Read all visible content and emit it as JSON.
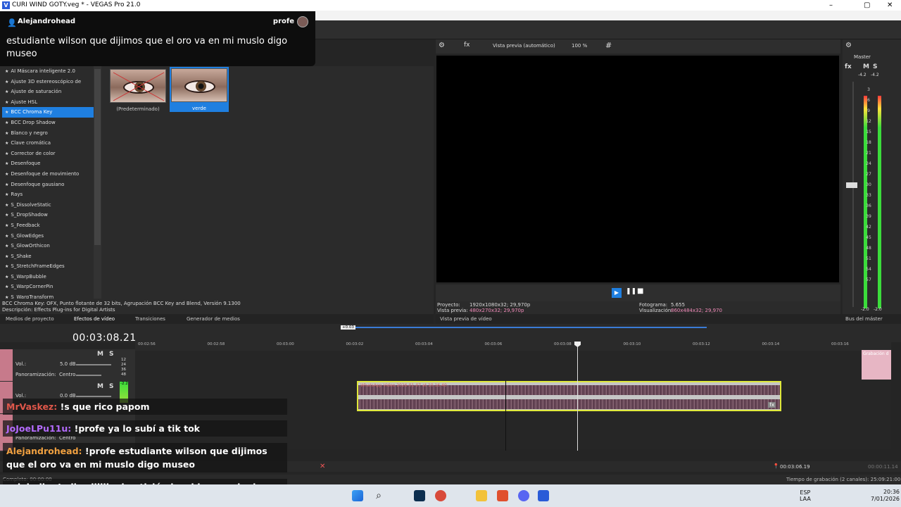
{
  "window": {
    "logo": "V",
    "title": "CURI WIND GOTY.veg * - VEGAS Pro 21.0",
    "minimize": "–",
    "maximize": "▢",
    "close": "✕"
  },
  "stream_overlay": {
    "username": "Alejandrohead",
    "badge": "profe",
    "message": "estudiante wilson que dijimos que el oro va en mi muslo digo museo"
  },
  "effects": {
    "list": [
      "AI Máscara inteligente 2.0",
      "Ajuste 3D estereoscópico de",
      "Ajuste de saturación",
      "Ajuste HSL",
      "BCC Chroma Key",
      "BCC Drop Shadow",
      "Blanco y negro",
      "Clave cromática",
      "Corrector de color",
      "Desenfoque",
      "Desenfoque de movimiento",
      "Desenfoque gausiano",
      "Rays",
      "S_DissolveStatic",
      "S_DropShadow",
      "S_Feedback",
      "S_GlowEdges",
      "S_GlowOrthicon",
      "S_Shake",
      "S_StretchFrameEdges",
      "S_WarpBubble",
      "S_WarpCornerPin",
      "S_WarpTransform"
    ],
    "selected_index": 4,
    "presets": [
      {
        "label": "(Predeterminado)"
      },
      {
        "label": "verde"
      }
    ],
    "description_line1": "BCC Chroma Key: OFX, Punto flotante de 32 bits, Agrupación BCC Key and Blend, Versión 9.1300",
    "description_line2": "Descripción: Effects Plug-ins for Digital Artists"
  },
  "left_tabs": [
    "Medios de proyecto",
    "Efectos de vídeo",
    "Transiciones",
    "Generador de medios"
  ],
  "preview": {
    "mode": "Vista previa (automático)",
    "zoom": "100 %",
    "proyecto_label": "Proyecto:",
    "proyecto_value": "1920x1080x32; 29,970p",
    "vista_label": "Vista previa:",
    "vista_value": "480x270x32; 29,970p",
    "fotograma_label": "Fotograma:",
    "fotograma_value": "5.655",
    "visualizacion_label": "Visualización:",
    "visualizacion_value": "860x484x32; 29,970",
    "tab": "Vista previa de vídeo"
  },
  "master": {
    "label": "Master",
    "peak_left": "-4.2",
    "peak_right": "-4.2",
    "scale": [
      "3",
      "6",
      "9",
      "12",
      "15",
      "18",
      "21",
      "24",
      "27",
      "30",
      "33",
      "36",
      "39",
      "42",
      "45",
      "48",
      "51",
      "54",
      "57"
    ],
    "bottom_left": "-2.0",
    "bottom_right": "-2.0",
    "tab": "Bus del máster"
  },
  "timeline": {
    "timecode": "00:03:08.21",
    "region_label": "+0.03",
    "ruler": [
      "00:02:56",
      "00:02:58",
      "00:03:00",
      "00:03:02",
      "00:03:04",
      "00:03:06",
      "00:03:08",
      "00:03:10",
      "00:03:12",
      "00:03:14",
      "00:03:16"
    ],
    "track1": {
      "vol_label": "Vol.:",
      "vol": "5.0 dB",
      "pan_label": "Panoramización:",
      "pan": "Centro",
      "m": "M",
      "s": "S",
      "meter": [
        "12",
        "24",
        "36",
        "48"
      ]
    },
    "track2": {
      "vol_label": "Vol.:",
      "vol": "0.0 dB",
      "m": "M",
      "s": "S",
      "peak": "-2.2"
    },
    "track3": {
      "pan_label": "Panoramización:",
      "pan": "Centro"
    },
    "clip_label": "WhatsApp Video 2026-01-07 at 10.16.40",
    "right_clip_label": "Grabación d",
    "cursor_time": "00:03:06.19",
    "end_time": "00:00:11.14",
    "status_left": "Completo: 00:00:00",
    "status_right": "Tiempo de grabación (2 canales): 25:09:21:00"
  },
  "chat": [
    {
      "user": "MrVaskez:",
      "text": "!s que rico papom",
      "color": "#e0574a"
    },
    {
      "user": "JoJoeLPu11u:",
      "text": "!profe ya lo subí a tik tok",
      "color": "#b46bff"
    },
    {
      "user": "Alejandrohead:",
      "text": "!profe estudiante wilson que dijimos que el oro va en mi muslo digo museo",
      "color": "#f0a040"
    },
    {
      "user": "calebgilv:",
      "text": "!milo siiiiii mi petición ha sido escuchadaaa",
      "color": "#ffffff"
    }
  ],
  "taskbar": {
    "lang1": "ESP",
    "lang2": "LAA",
    "time": "20:36",
    "date": "7/01/2026"
  }
}
